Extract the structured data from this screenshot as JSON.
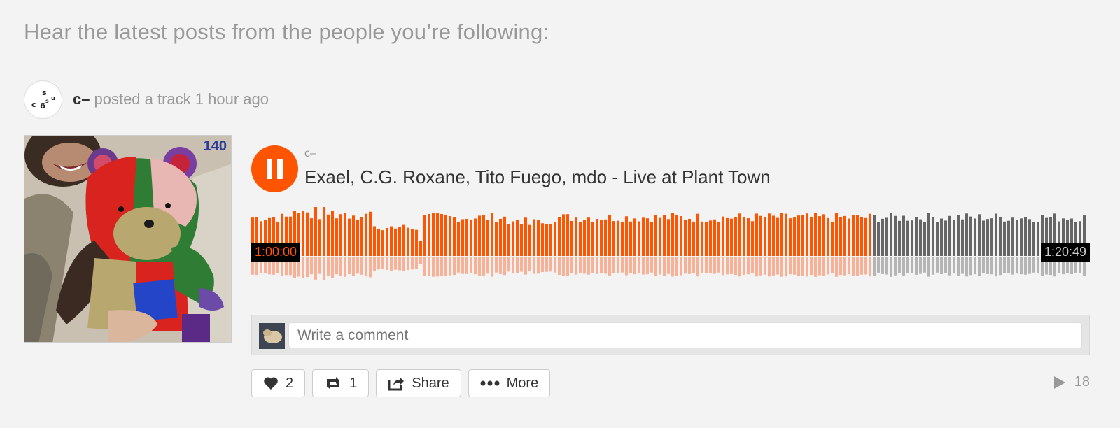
{
  "heading": "Hear the latest posts from the people you’re following:",
  "poster": {
    "username": "c–",
    "action": "posted a track 1 hour ago",
    "avatar_letters": [
      "c",
      "s",
      "g",
      "s",
      "u"
    ]
  },
  "artwork": {
    "label": "140"
  },
  "track": {
    "user": "c–",
    "title": "Exael, C.G. Roxane, Tito Fuego, mdo - Live at Plant Town",
    "state": "playing",
    "elapsed": "1:00:00",
    "duration": "1:20:49",
    "progress": 0.7426
  },
  "colors": {
    "accent": "#ff5500",
    "played_reflection": "#f8b097",
    "unplayed": "#666666",
    "unplayed_reflection": "#b5b5b5"
  },
  "comment": {
    "placeholder": "Write a comment"
  },
  "actions": {
    "like_count": "2",
    "repost_count": "1",
    "share_label": "Share",
    "more_label": "More"
  },
  "play_count": "18",
  "icons": {
    "play_pause": "pause-icon",
    "like": "heart-icon",
    "repost": "repost-icon",
    "share": "share-icon",
    "more": "more-dots-icon",
    "plays": "play-count-icon"
  }
}
